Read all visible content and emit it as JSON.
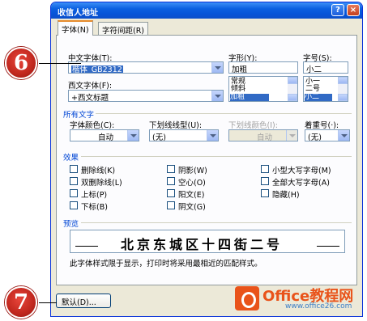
{
  "dialog": {
    "title": "收信人地址",
    "help_button": "?",
    "close_button": "×"
  },
  "tabs": [
    {
      "label": "字体(N)",
      "active": true
    },
    {
      "label": "字符间距(R)",
      "active": false
    }
  ],
  "font_section": {
    "chinese_font_label": "中文字体(T):",
    "chinese_font_value": "楷体_GB2312",
    "western_font_label": "西文字体(F):",
    "western_font_value": "+西文标题",
    "style_label": "字形(Y):",
    "style_value": "加粗",
    "style_options": [
      "常规",
      "倾斜",
      "加粗"
    ],
    "style_selected": "加粗",
    "size_label": "字号(S):",
    "size_value": "小二",
    "size_options": [
      "小一",
      "二号",
      "小二"
    ],
    "size_selected": "小二"
  },
  "all_text": {
    "group_label": "所有文字",
    "color_label": "字体颜色(C):",
    "color_value": "自动",
    "underline_label": "下划线线型(U):",
    "underline_value": "(无)",
    "underline_color_label": "下划线颜色(I):",
    "underline_color_value": "自动",
    "emphasis_label": "着重号(·):",
    "emphasis_value": "(无)"
  },
  "effects": {
    "group_label": "效果",
    "items": [
      {
        "label": "删除线(K)",
        "checked": false
      },
      {
        "label": "双删除线(L)",
        "checked": false
      },
      {
        "label": "上标(P)",
        "checked": false
      },
      {
        "label": "下标(B)",
        "checked": false
      },
      {
        "label": "阴影(W)",
        "checked": false
      },
      {
        "label": "空心(O)",
        "checked": false
      },
      {
        "label": "阳文(E)",
        "checked": false
      },
      {
        "label": "阴文(G)",
        "checked": false
      },
      {
        "label": "小型大写字母(M)",
        "checked": false
      },
      {
        "label": "全部大写字母(A)",
        "checked": false
      },
      {
        "label": "隐藏(H)",
        "checked": false
      }
    ]
  },
  "preview": {
    "group_label": "预览",
    "sample_text": "北京东城区十四街二号",
    "note": "此字体样式限于显示，打印时将采用最相近的匹配样式。"
  },
  "footer": {
    "default_button": "默认(D)..."
  },
  "callouts": [
    "6",
    "7"
  ],
  "watermark": {
    "title": "Office教程网",
    "url": "www.office26.com"
  },
  "colors": {
    "title_bar": "#0a5fe0",
    "group_label": "#0046d5",
    "selection": "#316ac5",
    "callout": "#c0271e",
    "watermark": "#e9531a"
  }
}
